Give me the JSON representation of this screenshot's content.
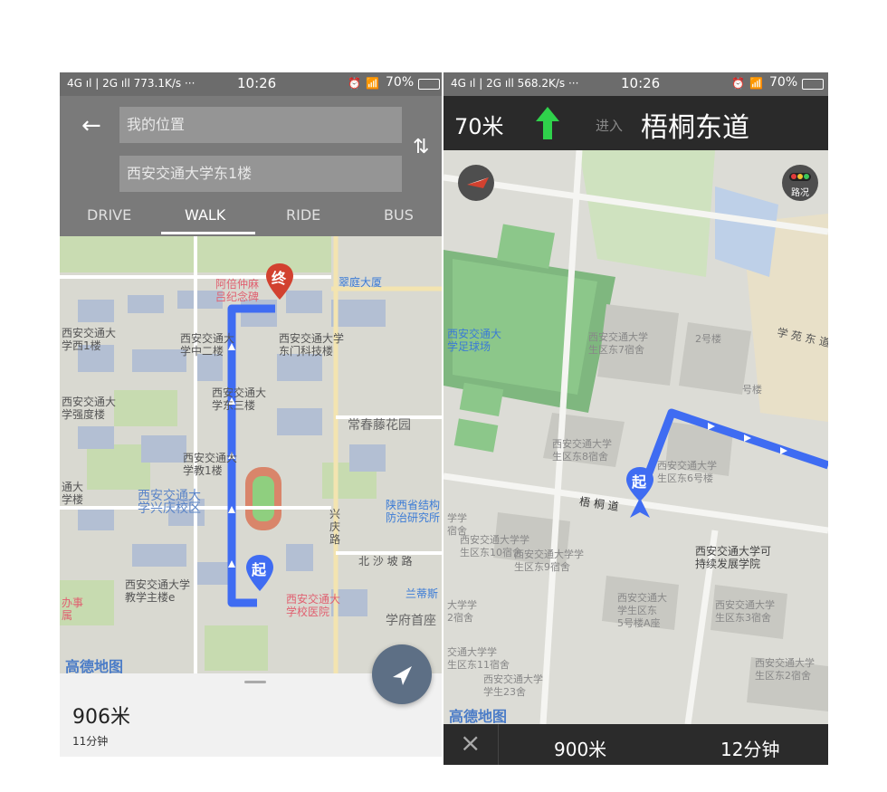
{
  "left": {
    "status": {
      "network": "4G ıl | 2G ıll 773.1K/s ···",
      "time": "10:26",
      "battery": "70%"
    },
    "search": {
      "from_placeholder": "我的位置",
      "to_value": "西安交通大学东1楼"
    },
    "modes": [
      "DRIVE",
      "WALK",
      "RIDE",
      "BUS"
    ],
    "active_mode": "WALK",
    "map": {
      "end_marker": "终",
      "start_marker": "起",
      "logo": "高德地图",
      "labels": {
        "xi_an_jiaotong_west1": "西安交通大\n学西1楼",
        "xi_an_jiaotong_zhong": "西安交通大\n学中二楼",
        "east_gate_building": "西安交通大学\n东门科技楼",
        "qiangdu": "西安交通大\n学强度楼",
        "dong3": "西安交通大\n学东三楼",
        "changchun": "常春藤花园",
        "jiao1": "西安交通大\n学教1楼",
        "xingqing": "西安交通大\n学兴庆校区",
        "shaanxi_inst": "陕西省结构\n防治研究所",
        "main_building": "西安交通大学\n教学主楼e",
        "beisha_road": "北 沙 坡 路",
        "hospital": "西安交通大\n学校医院",
        "xuefu": "学府首座",
        "cuiting": "翠庭大厦",
        "abei": "阿倍仲麻\n吕纪念碑",
        "xingqing_rd": "兴\n庆\n路",
        "lanti": "兰蒂斯",
        "tonglou": "通大\n学楼",
        "banshi": "办事\n属"
      }
    },
    "summary": {
      "distance": "906米",
      "duration": "11分钟"
    }
  },
  "right": {
    "status": {
      "network": "4G ıl | 2G ıll 568.2K/s ···",
      "time": "10:26",
      "battery": "70%"
    },
    "nav": {
      "distance": "70米",
      "enter": "进入",
      "road": "梧桐东道"
    },
    "traffic_label": "路况",
    "map": {
      "start_marker": "起",
      "logo": "高德地图",
      "labels": {
        "stadium": "西安交通大\n学足球场",
        "east7": "西安交通大学\n生区东7宿舍",
        "east2_floor": "2号楼",
        "xueyuan_rd": "学 苑 东 道",
        "building_no": "号楼",
        "east8": "西安交通大学\n生区东8宿舍",
        "east6": "西安交通大学\n生区东6号楼",
        "sust": "西安交通大学可\n持续发展学院",
        "east10": "西安交通大学学\n生区东10宿舍",
        "east9": "西安交通大学学\n生区东9宿舍",
        "east5": "西安交通大\n学生区东\n5号楼A座",
        "east3": "西安交通大学\n生区东3宿舍",
        "east11": "交通大学学\n生区东11宿舍",
        "stu23": "西安交通大学\n学生23舍",
        "east2": "西安交通大学\n生区东2宿舍",
        "xue2": "大学学\n2宿舍",
        "xuesheng": "学学\n宿舍",
        "road_wutong": "梧 桐 道"
      }
    },
    "bottom": {
      "close": "×",
      "distance": "900米",
      "duration": "12分钟"
    }
  },
  "colors": {
    "route": "#3f6cf2",
    "end_marker": "#d2412f",
    "start_marker": "#3f6cf2",
    "nav_arrow": "#2fd24b"
  }
}
